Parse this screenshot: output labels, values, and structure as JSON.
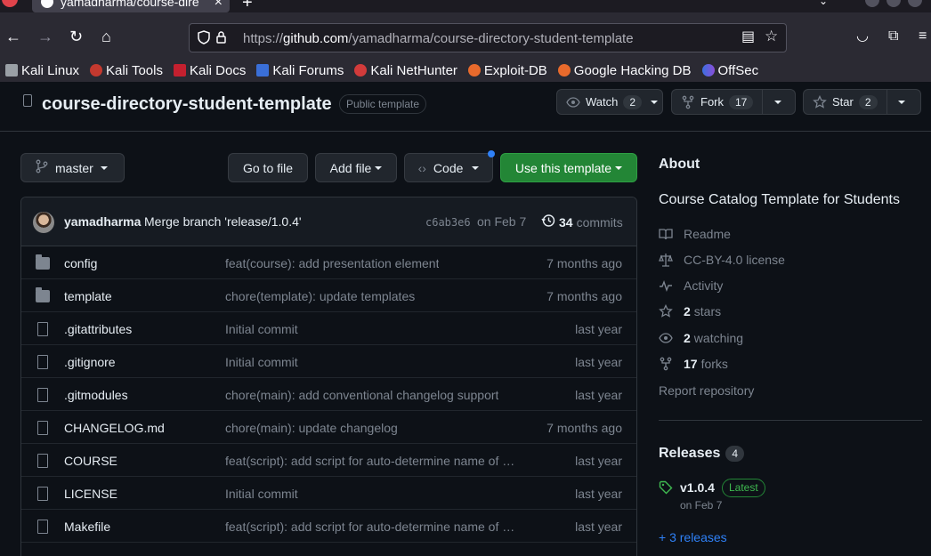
{
  "browser": {
    "tab_title": "yamadharma/course-dire",
    "url_prefix": "https://",
    "url_host": "github.com",
    "url_path": "/yamadharma/course-directory-student-template",
    "bookmarks": [
      "Kali Linux",
      "Kali Tools",
      "Kali Docs",
      "Kali Forums",
      "Kali NetHunter",
      "Exploit-DB",
      "Google Hacking DB",
      "OffSec"
    ]
  },
  "repo": {
    "name": "course-directory-student-template",
    "visibility_badge": "Public template",
    "watch_label": "Watch",
    "watch_count": "2",
    "fork_label": "Fork",
    "fork_count": "17",
    "star_label": "Star",
    "star_count": "2"
  },
  "toolbar": {
    "branch": "master",
    "go_to_file": "Go to file",
    "add_file": "Add file",
    "code": "Code",
    "use_template": "Use this template"
  },
  "latest_commit": {
    "author": "yamadharma",
    "message": "Merge branch 'release/1.0.4'",
    "sha": "c6ab3e6",
    "date": "on Feb 7",
    "commit_count": "34",
    "commits_label": "commits"
  },
  "files": [
    {
      "name": "config",
      "type": "dir",
      "message": "feat(course): add presentation element",
      "age": "7 months ago"
    },
    {
      "name": "template",
      "type": "dir",
      "message": "chore(template): update templates",
      "age": "7 months ago"
    },
    {
      "name": ".gitattributes",
      "type": "file",
      "message": "Initial commit",
      "age": "last year"
    },
    {
      "name": ".gitignore",
      "type": "file",
      "message": "Initial commit",
      "age": "last year"
    },
    {
      "name": ".gitmodules",
      "type": "file",
      "message": "chore(main): add conventional changelog support",
      "age": "last year"
    },
    {
      "name": "CHANGELOG.md",
      "type": "file",
      "message": "chore(main): update changelog",
      "age": "7 months ago"
    },
    {
      "name": "COURSE",
      "type": "file",
      "message": "feat(script): add script for auto-determine name of …",
      "age": "last year"
    },
    {
      "name": "LICENSE",
      "type": "file",
      "message": "Initial commit",
      "age": "last year"
    },
    {
      "name": "Makefile",
      "type": "file",
      "message": "feat(script): add script for auto-determine name of …",
      "age": "last year"
    }
  ],
  "about": {
    "heading": "About",
    "description": "Course Catalog Template for Students",
    "readme": "Readme",
    "license": "CC-BY-4.0 license",
    "activity": "Activity",
    "stars_count": "2",
    "stars_label": "stars",
    "watching_count": "2",
    "watching_label": "watching",
    "forks_count": "17",
    "forks_label": "forks",
    "report": "Report repository"
  },
  "releases": {
    "heading": "Releases",
    "count": "4",
    "version": "v1.0.4",
    "latest_badge": "Latest",
    "date": "on Feb 7",
    "more": "+ 3 releases"
  }
}
